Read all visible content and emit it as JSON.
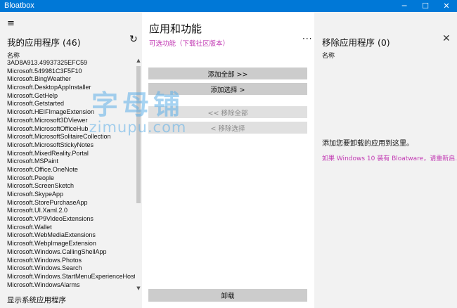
{
  "window": {
    "title": "Bloatbox",
    "minimize_icon": "─",
    "maximize_icon": "☐",
    "close_icon": "✕"
  },
  "left_panel": {
    "menu_icon": "≡",
    "title": "我的应用程序 (46)",
    "refresh_icon": "↻",
    "column_header": "名称",
    "apps": [
      "3AD8A913.49937325EFC59",
      "Microsoft.549981C3F5F10",
      "Microsoft.BingWeather",
      "Microsoft.DesktopAppInstaller",
      "Microsoft.GetHelp",
      "Microsoft.Getstarted",
      "Microsoft.HEIFImageExtension",
      "Microsoft.Microsoft3DViewer",
      "Microsoft.MicrosoftOfficeHub",
      "Microsoft.MicrosoftSolitaireCollection",
      "Microsoft.MicrosoftStickyNotes",
      "Microsoft.MixedReality.Portal",
      "Microsoft.MSPaint",
      "Microsoft.Office.OneNote",
      "Microsoft.People",
      "Microsoft.ScreenSketch",
      "Microsoft.SkypeApp",
      "Microsoft.StorePurchaseApp",
      "Microsoft.UI.Xaml.2.0",
      "Microsoft.VP9VideoExtensions",
      "Microsoft.Wallet",
      "Microsoft.WebMediaExtensions",
      "Microsoft.WebpImageExtension",
      "Microsoft.Windows.CallingShellApp",
      "Microsoft.Windows.Photos",
      "Microsoft.Windows.Search",
      "Microsoft.Windows.StartMenuExperienceHost",
      "Microsoft.WindowsAlarms"
    ],
    "scroll_up": "▲",
    "scroll_down": "▼",
    "show_system_label": "显示系统应用程序"
  },
  "center_panel": {
    "title": "应用和功能",
    "optional_link": "可选功能（下载社区版本）",
    "more_icon": "···",
    "add_all_label": "添加全部 >>",
    "add_selected_label": "添加选择 >",
    "remove_all_label": "<< 移除全部",
    "remove_selected_label": "< 移除选择",
    "uninstall_label": "卸载",
    "watermark_line1": "字母铺",
    "watermark_line2": "zimupu.com"
  },
  "right_panel": {
    "title": "移除应用程序 (0)",
    "close_icon": "✕",
    "column_header": "名称",
    "empty_message": "添加您要卸载的应用到这里。",
    "bloatware_link": "如果 Windows 10 装有 Bloatware，请重新启..."
  },
  "colors": {
    "titlebar": "#0078d7",
    "accent_link": "#c239b3",
    "button": "#cccccc",
    "panel_bg": "#f2f2f2"
  }
}
